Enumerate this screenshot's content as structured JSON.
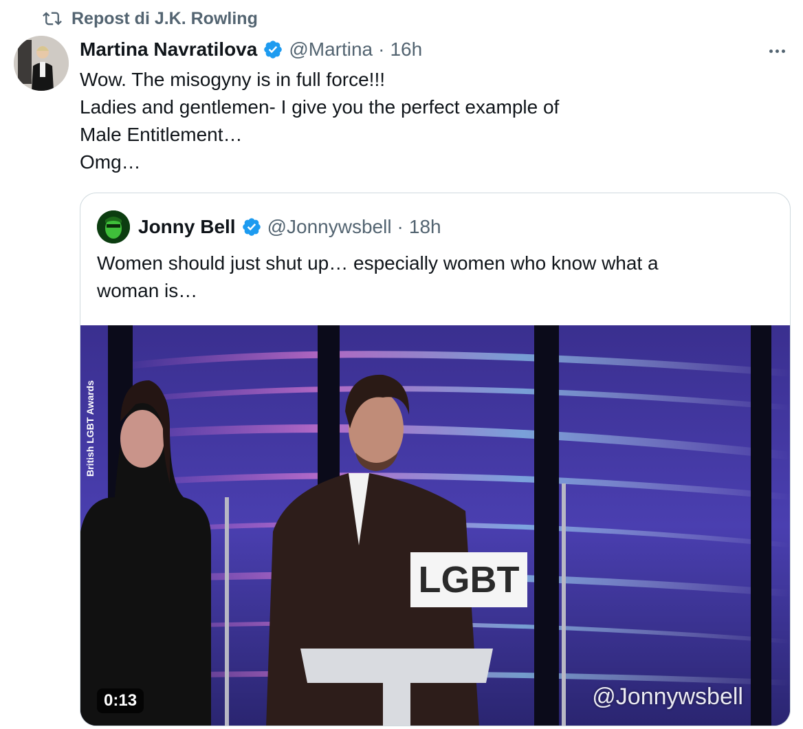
{
  "repost": {
    "label": "Repost di J.K. Rowling",
    "icon": "repost-icon"
  },
  "tweet": {
    "author_name": "Martina Navratilova",
    "handle": "@Martina",
    "separator": "·",
    "time": "16h",
    "lines": [
      "Wow. The misogyny is in full force!!!",
      "Ladies and gentlemen- I give you the perfect example of",
      "Male Entitlement…",
      "Omg…"
    ],
    "verified_color": "#1d9bf0"
  },
  "quote": {
    "author_name": "Jonny Bell",
    "handle": "@Jonnywsbell",
    "separator": "·",
    "time": "18h",
    "lines": [
      "Women should just shut up… especially women who know what a",
      "woman is…"
    ],
    "video": {
      "duration": "0:13",
      "watermark": "@Jonnywsbell",
      "side_label": "British LGBT Awards",
      "sign_text": "LGBT"
    }
  }
}
